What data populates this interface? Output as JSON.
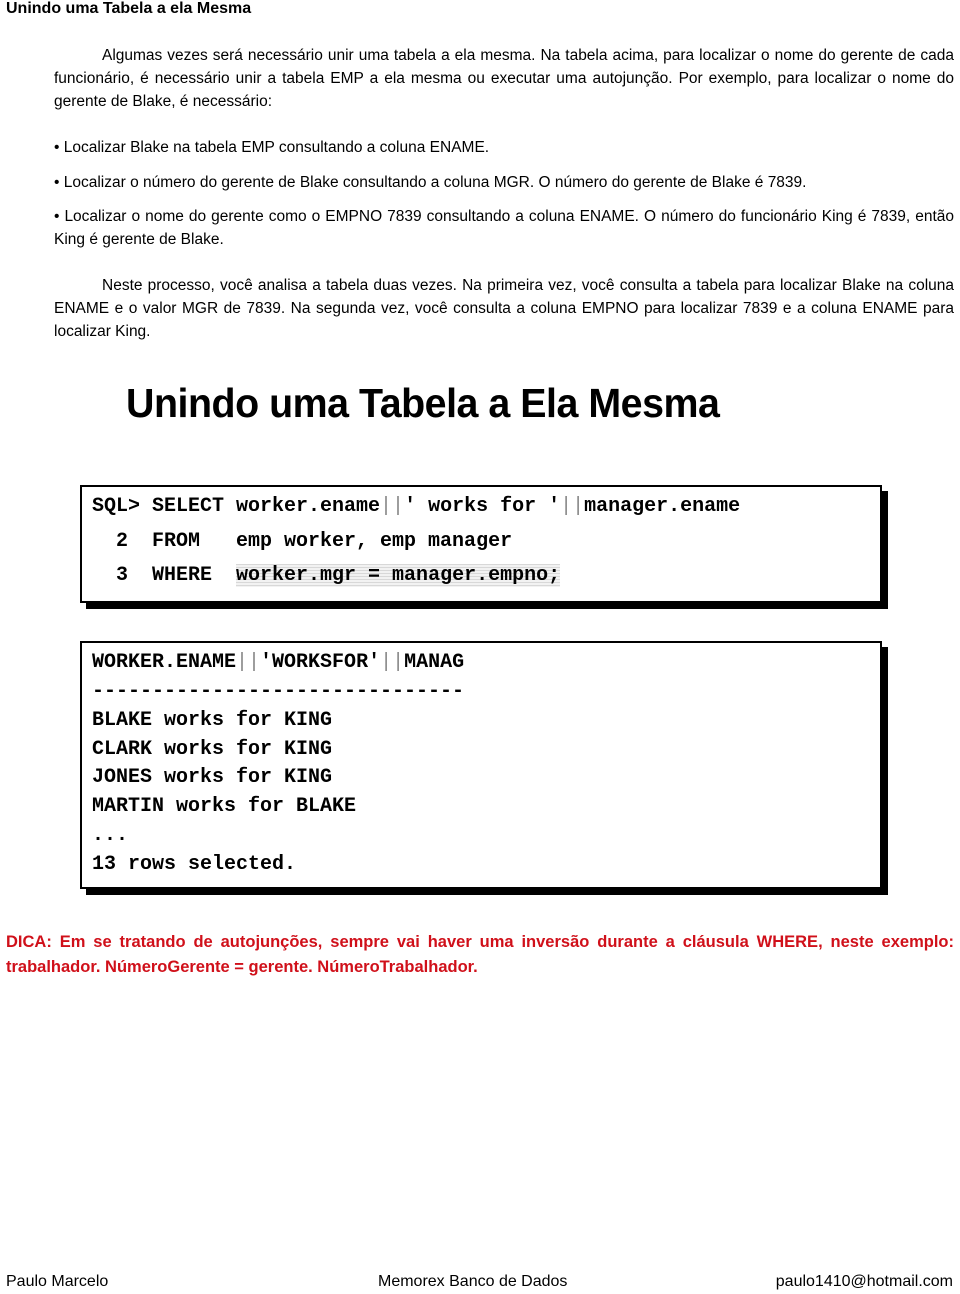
{
  "title": "Unindo uma Tabela a ela Mesma",
  "intro": "Algumas vezes será necessário unir uma tabela a ela mesma. Na tabela acima, para localizar o nome do gerente de cada funcionário, é necessário unir a tabela EMP a ela mesma ou executar uma autojunção. Por exemplo, para localizar o nome do gerente de Blake, é necessário:",
  "bullets": [
    "• Localizar Blake na tabela EMP consultando a coluna ENAME.",
    "• Localizar o número do gerente de Blake consultando a coluna MGR. O número do gerente de Blake é 7839.",
    "• Localizar o nome do gerente como o EMPNO 7839 consultando a coluna ENAME. O número do funcionário King é 7839, então King é gerente de Blake."
  ],
  "process": "Neste processo, você analisa a tabela duas vezes. Na primeira vez, você consulta a tabela para localizar Blake na coluna ENAME e o valor MGR de 7839. Na segunda vez, você consulta a coluna EMPNO para localizar 7839 e a coluna ENAME para localizar King.",
  "slide": {
    "title": "Unindo uma Tabela a Ela Mesma",
    "query": {
      "line1": {
        "prefix": "SQL> SELECT worker.ename",
        "mid": "' works for '",
        "suffix": "manager.ename"
      },
      "line2": "  2  FROM   emp worker, emp manager",
      "line3_prefix": "  3  WHERE  ",
      "line3_hl": "worker.mgr = manager.empno;"
    },
    "result": {
      "header": {
        "col1": "WORKER.ENAME",
        "col2": "'WORKSFOR'",
        "col3": "MANAG"
      },
      "separator": "-------------------------------",
      "rows": [
        "BLAKE works for KING",
        "CLARK works for KING",
        "JONES works for KING",
        "MARTIN works for BLAKE"
      ],
      "ellipsis": "...",
      "footer": "13 rows selected."
    }
  },
  "tip": "DICA: Em se tratando de autojunções, sempre vai haver uma inversão durante a cláusula WHERE, neste exemplo:  trabalhador. NúmeroGerente = gerente. NúmeroTrabalhador.",
  "footer": {
    "author": "Paulo Marcelo",
    "center": "Memorex Banco de Dados",
    "email": "paulo1410@hotmail.com"
  }
}
